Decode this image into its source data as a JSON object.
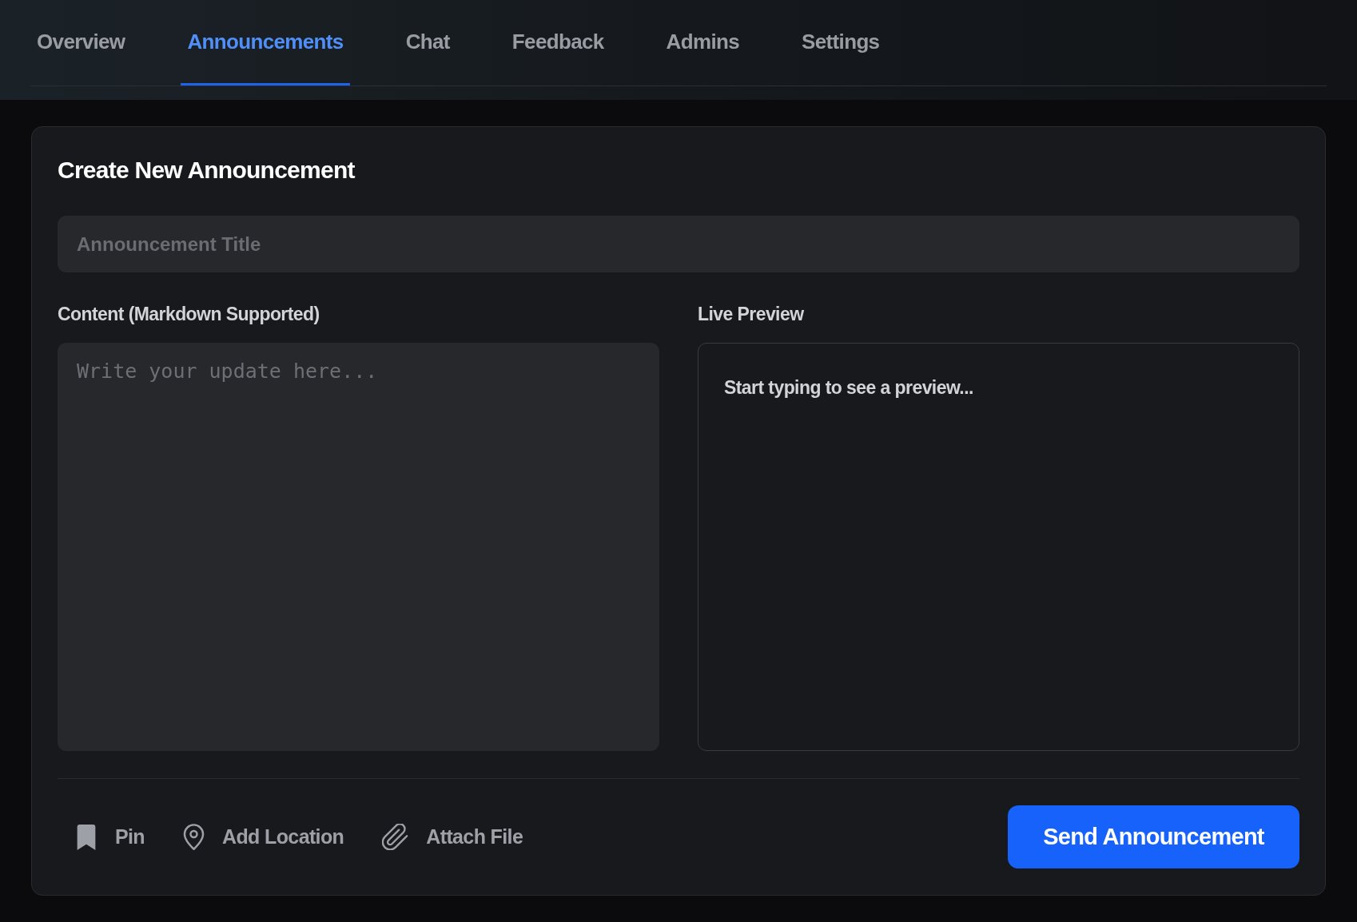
{
  "tabs": [
    {
      "label": "Overview",
      "selected": false
    },
    {
      "label": "Announcements",
      "selected": true
    },
    {
      "label": "Chat",
      "selected": false
    },
    {
      "label": "Feedback",
      "selected": false
    },
    {
      "label": "Admins",
      "selected": false
    },
    {
      "label": "Settings",
      "selected": false
    }
  ],
  "composer": {
    "heading": "Create New Announcement",
    "title_field": {
      "placeholder": "Announcement Title"
    },
    "content": {
      "label": "Content (Markdown Supported)",
      "placeholder": "Write your update here..."
    },
    "preview": {
      "label": "Live Preview",
      "text": "Start typing to see a preview..."
    },
    "tools": [
      {
        "kind": "pin",
        "label": "Pin"
      },
      {
        "kind": "location",
        "label": "Add Location"
      },
      {
        "kind": "attach",
        "label": "Attach File"
      }
    ],
    "submit": "Send Announcement"
  }
}
